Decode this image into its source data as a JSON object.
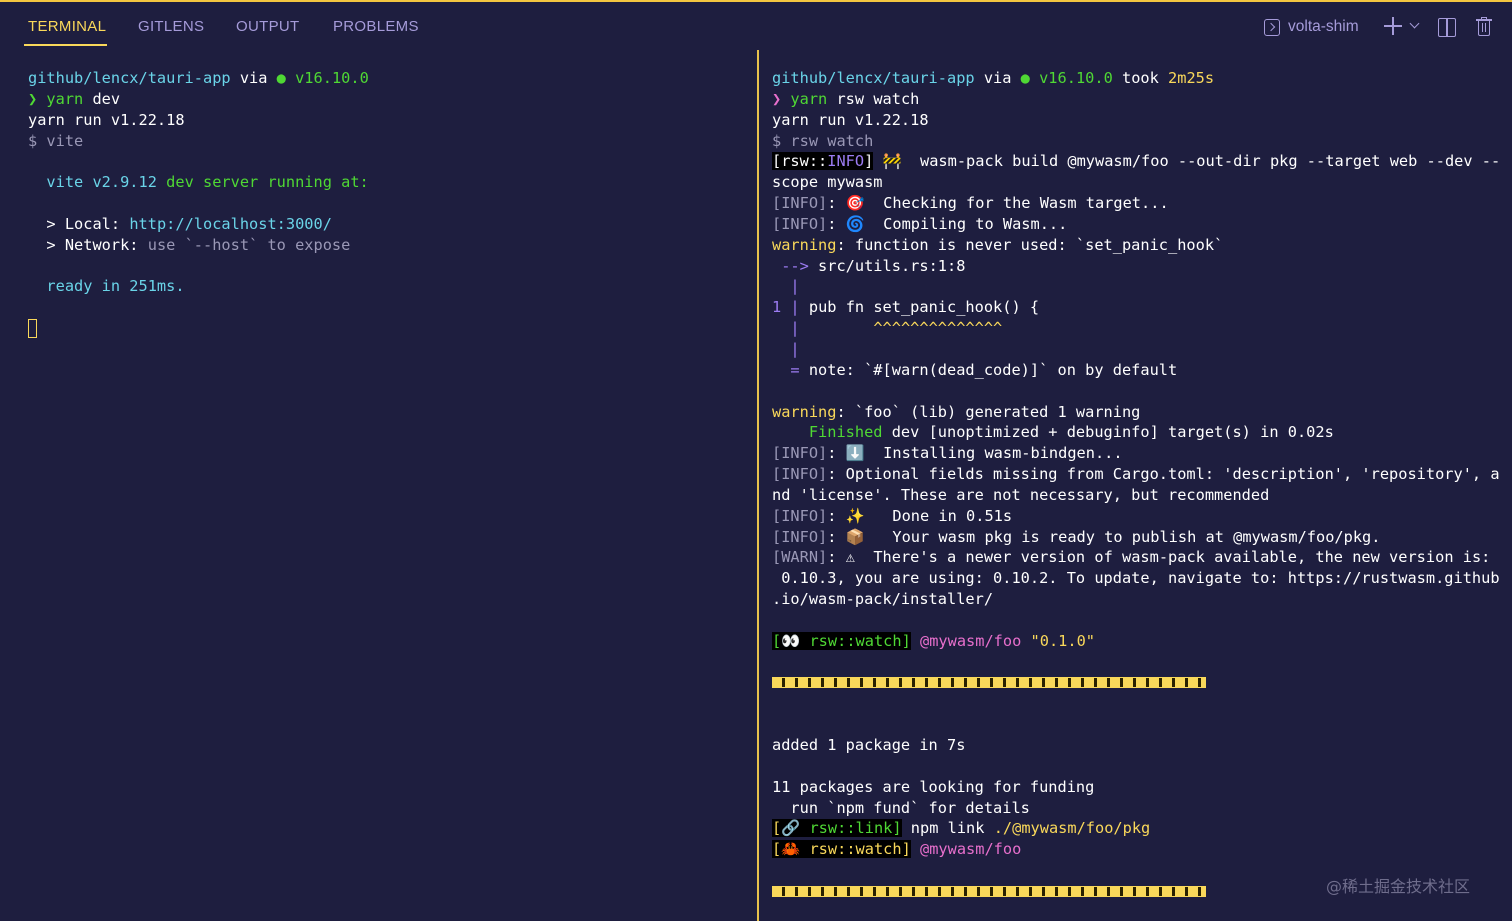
{
  "tabs": [
    {
      "label": "TERMINAL",
      "active": true
    },
    {
      "label": "GITLENS",
      "active": false
    },
    {
      "label": "OUTPUT",
      "active": false
    },
    {
      "label": "PROBLEMS",
      "active": false
    }
  ],
  "toolbar": {
    "shell_name": "volta-shim",
    "icons": [
      "terminal-shell-icon",
      "plus-icon",
      "chevron-down-icon",
      "split-terminal-icon",
      "trash-icon"
    ]
  },
  "colors": {
    "background": "#1e1e3f",
    "accent_yellow": "#f9d85a",
    "cyan": "#6ad4e8",
    "green": "#4fd834",
    "pink": "#e76fcc",
    "muted": "#9a98b6",
    "tab_text": "#a59bd9"
  },
  "left": {
    "l1_path": "github/lencx/tauri-app",
    "l1_via": " via ",
    "l1_dot": "●",
    "l1_ver": " v16.10.0",
    "l2_prompt": "❯ ",
    "l2_cmd": "yarn",
    "l2_arg": " dev",
    "l3": "yarn run v1.22.18",
    "l4": "$ vite",
    "l6_vite": "  vite v2.9.12",
    "l6_rest": " dev server running at:",
    "l8_label": "  > Local: ",
    "l8_url": "http://localhost:3000/",
    "l9_label": "  > Network: ",
    "l9_rest": "use `--host` to expose",
    "l11_ready": "  ready in 251ms."
  },
  "right": {
    "r1_path": "github/lencx/tauri-app",
    "r1_via": " via ",
    "r1_dot": "●",
    "r1_ver": " v16.10.0",
    "r1_took": " took ",
    "r1_time": "2m25s",
    "r2_prompt": "❯ ",
    "r2_cmd": "yarn",
    "r2_arg": " rsw watch",
    "r3": "yarn run v1.22.18",
    "r4": "$ rsw watch",
    "r5_open": "[rsw::",
    "r5_info": "INFO",
    "r5_close": "]",
    "r5_emoji": " 🚧",
    "r5_rest": "  wasm-pack build @mywasm/foo --out-dir pkg --target web --dev --",
    "r6": "scope mywasm",
    "r7_tag": "[INFO]",
    "r7_colon": ": ",
    "r7_emoji": "🎯",
    "r7_text": "  Checking for the Wasm target...",
    "r8_tag": "[INFO]",
    "r8_colon": ": ",
    "r8_emoji": "🌀",
    "r8_text": "  Compiling to Wasm...",
    "r9_warn": "warning",
    "r9_text": ": function is never used: `set_panic_hook`",
    "r10_arrow": " -->",
    "r10_text": " src/utils.rs:1:8",
    "r11": "  |",
    "r12_num": "1",
    "r12_bar": " | ",
    "r12_code": "pub fn set_panic_hook() {",
    "r13_bar": "  |",
    "r13_carets": "        ^^^^^^^^^^^^^^",
    "r14": "  |",
    "r15_eq": "  = ",
    "r15_text": "note: `#[warn(dead_code)]` on by default",
    "r17_warn": "warning",
    "r17_text": ": `foo` (lib) generated 1 warning",
    "r18_fin": "    Finished",
    "r18_text": " dev [unoptimized + debuginfo] target(s) in 0.02s",
    "r19_tag": "[INFO]",
    "r19_colon": ": ",
    "r19_emoji": "⬇️",
    "r19_text": "  Installing wasm-bindgen...",
    "r20_tag": "[INFO]",
    "r20_text": ": Optional fields missing from Cargo.toml: 'description', 'repository', a",
    "r21": "nd 'license'. These are not necessary, but recommended",
    "r22_tag": "[INFO]",
    "r22_colon": ": ",
    "r22_emoji": "✨",
    "r22_text": "   Done in 0.51s",
    "r23_tag": "[INFO]",
    "r23_colon": ": ",
    "r23_emoji": "📦",
    "r23_text": "   Your wasm pkg is ready to publish at @mywasm/foo/pkg.",
    "r24_tag": "[WARN]",
    "r24_colon": ": ",
    "r24_emoji": "⚠",
    "r24_text": "  There's a newer version of wasm-pack available, the new version is:",
    "r25": " 0.10.3, you are using: 0.10.2. To update, navigate to: https://rustwasm.github",
    "r26": ".io/wasm-pack/installer/",
    "r28_open": "[",
    "r28_emoji": "👀",
    "r28_tag": " rsw::watch",
    "r28_close": "]",
    "r28_pkg": " @mywasm/foo",
    "r28_ver": " \"0.1.0\"",
    "r33": "added 1 package in 7s",
    "r35": "11 packages are looking for funding",
    "r36": "  run `npm fund` for details",
    "r37_open": "[",
    "r37_emoji": "🔗",
    "r37_tag": " rsw::link",
    "r37_close": "]",
    "r37_cmd": " npm link",
    "r37_path": " ./@mywasm/foo/pkg",
    "r38_open": "[",
    "r38_emoji": "🦀",
    "r38_tag": " rsw::watch",
    "r38_close": "]",
    "r38_pkg": " @mywasm/foo"
  },
  "watermark": "@稀土掘金技术社区"
}
